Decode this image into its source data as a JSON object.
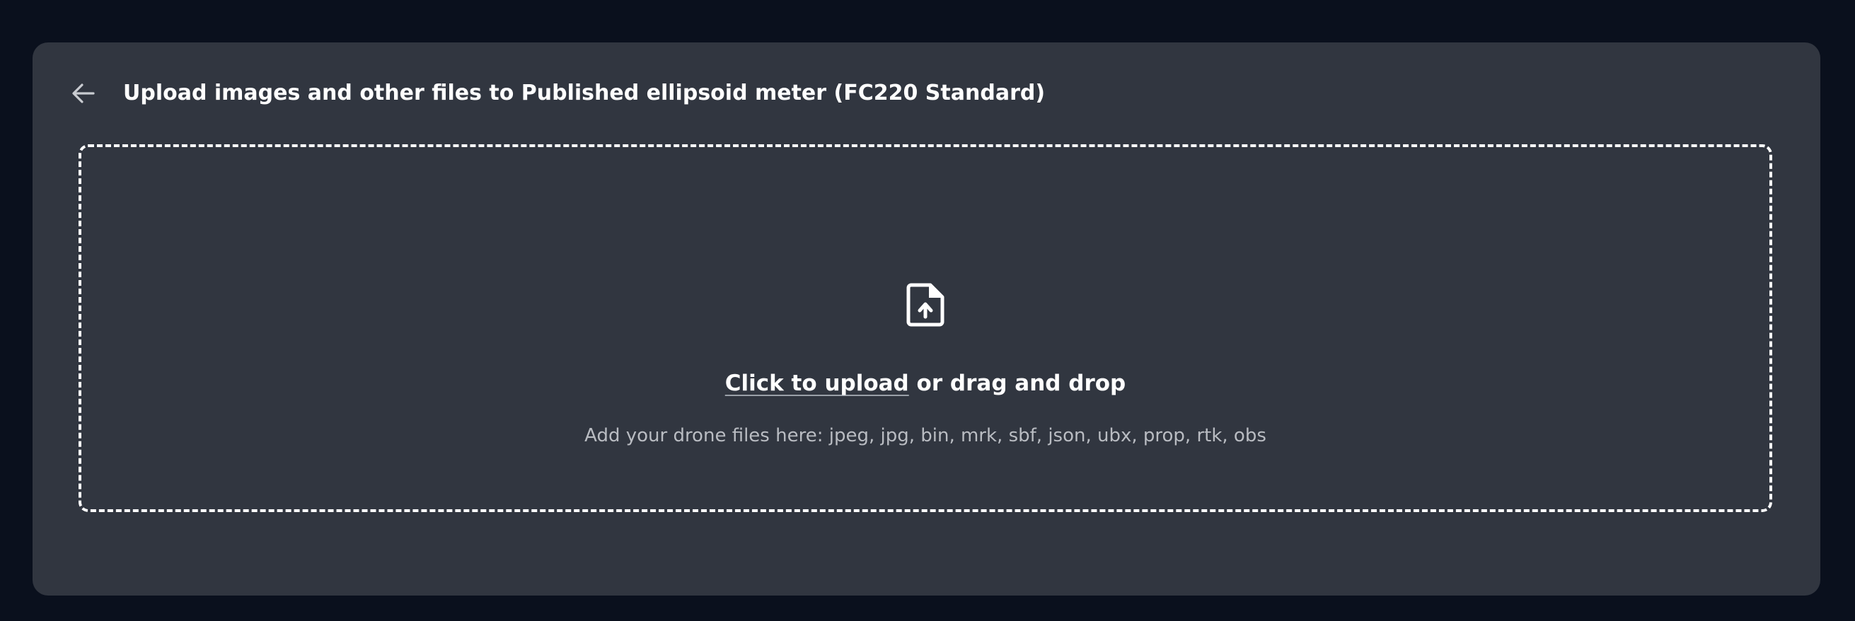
{
  "header": {
    "back_icon": "arrow-left-icon",
    "title": "Upload images and other files to Published ellipsoid meter (FC220 Standard)"
  },
  "dropzone": {
    "icon": "file-upload-icon",
    "click_label": "Click to upload",
    "drag_label": " or drag and drop",
    "hint": "Add your drone files here: jpeg, jpg, bin, mrk, sbf, json, ubx, prop, rtk, obs"
  },
  "colors": {
    "page_bg": "#0a101d",
    "card_bg": "#313640",
    "text": "#ffffff",
    "muted": "#b9bcc2"
  }
}
